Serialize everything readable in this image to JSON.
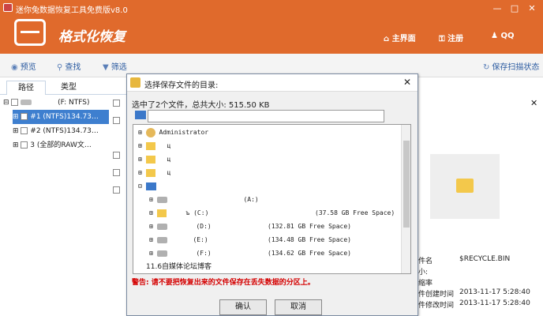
{
  "window": {
    "title": "迷你兔数据恢复工具免费版v8.0",
    "min": "—",
    "max": "□",
    "close": "✕"
  },
  "header": {
    "module": "格式化恢复",
    "nav": [
      {
        "label": "主界面",
        "icon": "home-icon"
      },
      {
        "label": "注册",
        "icon": "key-icon"
      },
      {
        "label": "QQ",
        "icon": "qq-icon"
      }
    ]
  },
  "toolbar": {
    "preview": "预览",
    "find": "查找",
    "filter": "筛选",
    "save_state": "保存扫描状态"
  },
  "tabs": [
    "路径",
    "类型"
  ],
  "left_tree": [
    {
      "expander": "⊟",
      "label": "(F: NTFS)"
    },
    {
      "expander": "⊞",
      "label": "#1  (NTFS)134.73…"
    },
    {
      "expander": "⊞",
      "label": "#2  (NTFS)134.73…"
    },
    {
      "expander": "⊞",
      "label": "3  (全部的RAW文…"
    }
  ],
  "properties": [
    {
      "key": "件名",
      "value": "$RECYCLE.BIN"
    },
    {
      "key": "小:",
      "value": ""
    },
    {
      "key": "缩率",
      "value": ""
    },
    {
      "key": "件创建时间",
      "value": "2013-11-17  5:28:40"
    },
    {
      "key": "件修改时间",
      "value": "2013-11-17  5:28:40"
    }
  ],
  "dialog": {
    "title": "选择保存文件的目录:",
    "close": "✕",
    "selection": "选中了2个文件，总共大小: 515.50 KB",
    "path": "",
    "tree": [
      {
        "label": "Administrator",
        "icon": "user-folder-icon",
        "expander": "⊞"
      },
      {
        "label": "ц",
        "icon": "folder-icon",
        "expander": "⊞"
      },
      {
        "label": "ц",
        "icon": "folder-icon",
        "expander": "⊞"
      },
      {
        "label": "ц",
        "icon": "folder-icon",
        "expander": "⊞"
      },
      {
        "label": "",
        "icon": "computer-icon",
        "expander": "⊟"
      },
      {
        "label": "(A:)",
        "icon": "drive-icon",
        "expander": "⊞"
      },
      {
        "label": "ъ         (C:)",
        "extra": "(37.58 GB Free Space)",
        "icon": "drive-icon",
        "expander": "⊞"
      },
      {
        "label": "(D:)",
        "extra": "(132.81 GB Free Space)",
        "icon": "drive-icon",
        "expander": "⊞"
      },
      {
        "label": "(E:)",
        "extra": "(134.48 GB Free Space)",
        "icon": "drive-icon",
        "expander": "⊞"
      },
      {
        "label": "(F:)",
        "extra": "(134.62 GB Free Space)",
        "icon": "drive-icon",
        "expander": "⊞"
      },
      {
        "label": "11.6自媒体论坛博客",
        "icon": "",
        "expander": ""
      }
    ],
    "warning": "警告: 请不要把恢复出来的文件保存在丢失数据的分区上。",
    "ok": "确认",
    "cancel": "取消"
  }
}
